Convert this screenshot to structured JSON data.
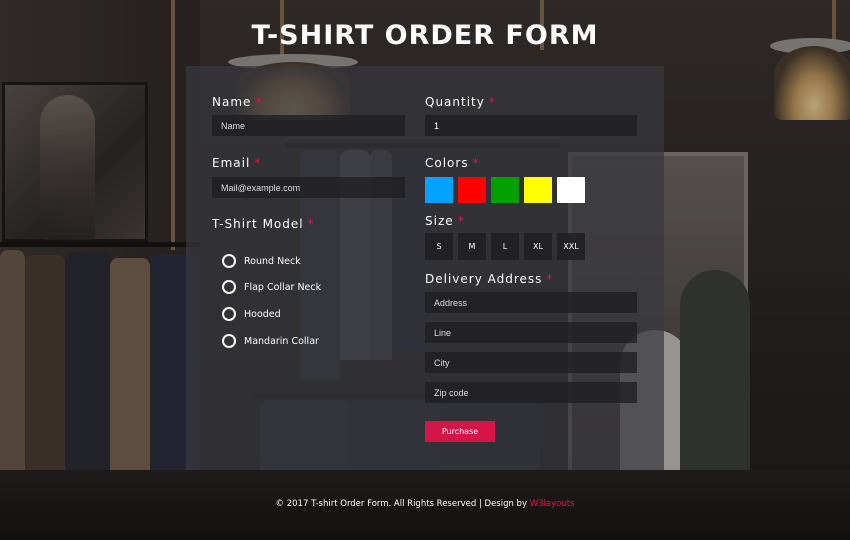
{
  "page": {
    "title": "T-SHIRT ORDER FORM"
  },
  "form": {
    "name": {
      "label": "Name",
      "required": "*",
      "placeholder": "Name"
    },
    "quantity": {
      "label": "Quantity",
      "required": "*",
      "value": "1"
    },
    "email": {
      "label": "Email",
      "required": "*",
      "placeholder": "Mail@example.com"
    },
    "colors": {
      "label": "Colors",
      "required": "*",
      "swatches": [
        "#00a2ff",
        "#ff0000",
        "#00a000",
        "#ffff00",
        "#ffffff"
      ]
    },
    "model": {
      "label": "T-Shirt Model",
      "required": "*",
      "options": [
        "Round Neck",
        "Flap Collar Neck",
        "Hooded",
        "Mandarin Collar"
      ]
    },
    "size": {
      "label": "Size",
      "required": "*",
      "options": [
        "S",
        "M",
        "L",
        "XL",
        "XXL"
      ]
    },
    "delivery": {
      "label": "Delivery Address",
      "required": "*",
      "placeholders": [
        "Address",
        "Line",
        "City",
        "Zip code"
      ]
    },
    "submit_label": "Purchase"
  },
  "footer": {
    "text": "© 2017 T-shirt Order Form. All Rights Reserved | Design by ",
    "link": "W3layouts"
  },
  "colors": {
    "accent": "#e2164a",
    "button": "#d31547",
    "panel": "rgba(55,55,62,0.72)"
  }
}
